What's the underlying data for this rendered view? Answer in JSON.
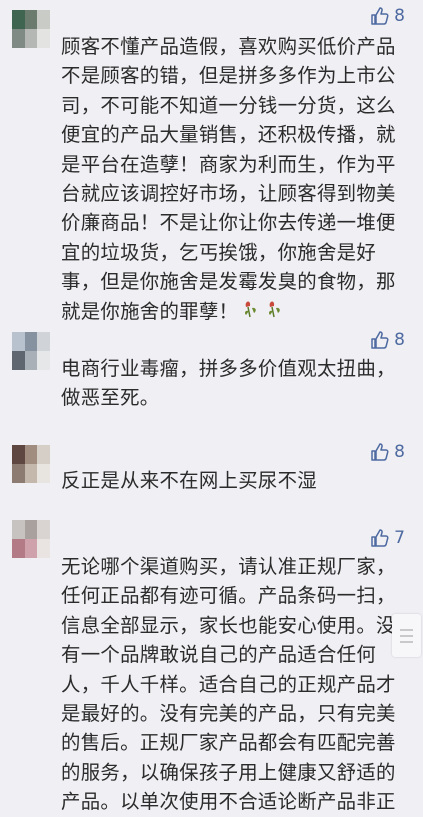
{
  "comments": [
    {
      "likes": "8",
      "avatar_colors": [
        "#4a6a55",
        "#6b7b6e",
        "#c9cbc6",
        "#8f8f8f",
        "#b5b7b4",
        "#e3e3e1"
      ],
      "text": "顾客不懂产品造假，喜欢购买低价产品不是顾客的错，但是拼多多作为上市公司，不可能不知道一分钱一分货，这么便宜的产品大量销售，还积极传播，就是平台在造孽！商家为利而生，作为平台就应该调控好市场，让顾客得到物美价廉商品！不是让你让你去传递一堆便宜的垃圾货，乞丐挨饿，你施舍是好事，但是你施舍是发霉发臭的食物，那就是你施舍的罪孽！"
    },
    {
      "likes": "8",
      "avatar_colors": [
        "#b8c2cf",
        "#7b8797",
        "#d0d4d8",
        "#5f6670",
        "#a9b0b8",
        "#e6e7e9"
      ],
      "text": "电商行业毒瘤，拼多多价值观太扭曲，做恶至死。"
    },
    {
      "likes": "8",
      "avatar_colors": [
        "#6b4f46",
        "#a08d7f",
        "#d6cfc7",
        "#8c7b70",
        "#c4b8ad",
        "#e8e4df"
      ],
      "text": "反正是从来不在网上买尿不湿"
    },
    {
      "likes": "7",
      "avatar_colors": [
        "#c7c3c0",
        "#a8a19d",
        "#d9d4d1",
        "#b37b86",
        "#cfa1aa",
        "#e9e3e1"
      ],
      "text": "无论哪个渠道购买，请认准正规厂家，任何正品都有迹可循。产品条码一扫，信息全部显示，家长也能安心使用。没有一个品牌敢说自己的产品适合任何人，千人千样。适合自己的正规产品才是最好的。没有完美的产品，只有完美的售后。正规厂家产品都会有匹配完善的服务，以确保孩子用上健康又舒适的产品。以单次使用不合适论断产品非正"
    }
  ]
}
